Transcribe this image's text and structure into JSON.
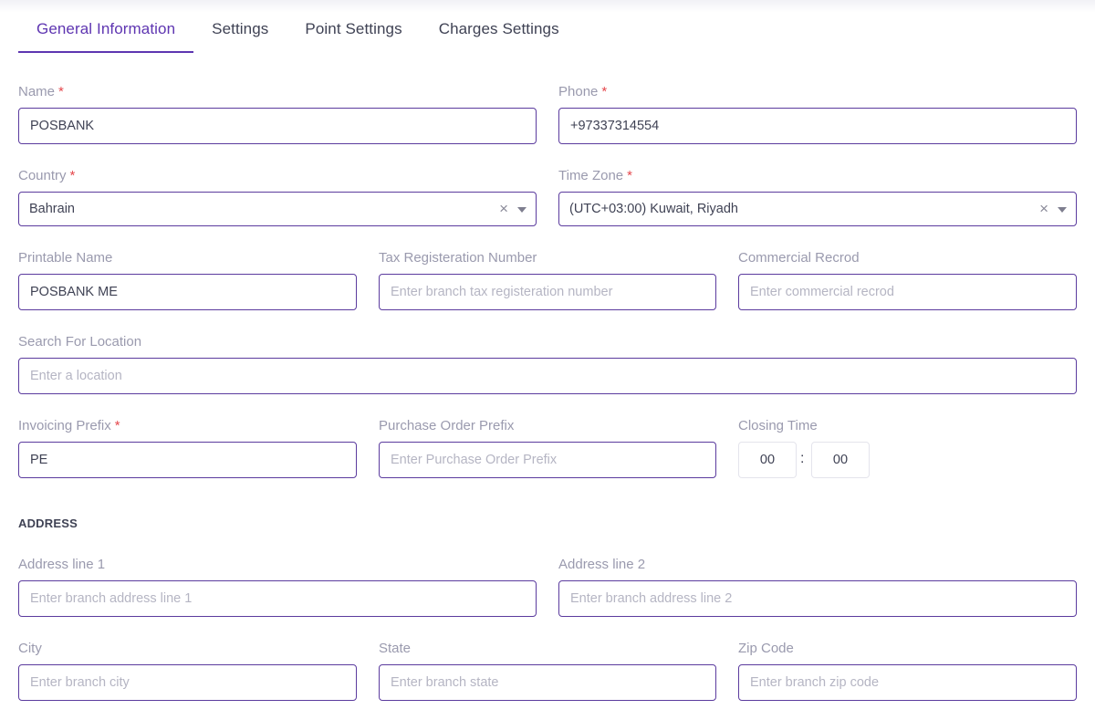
{
  "tabs": [
    "General Information",
    "Settings",
    "Point Settings",
    "Charges Settings"
  ],
  "form": {
    "name": {
      "label": "Name",
      "required": "*",
      "value": "POSBANK"
    },
    "phone": {
      "label": "Phone",
      "required": "*",
      "value": "+97337314554"
    },
    "country": {
      "label": "Country",
      "required": "*",
      "value": "Bahrain",
      "clear": "×"
    },
    "timezone": {
      "label": "Time Zone",
      "required": "*",
      "value": "(UTC+03:00) Kuwait, Riyadh",
      "clear": "×"
    },
    "printable_name": {
      "label": "Printable Name",
      "value": "POSBANK ME"
    },
    "tax_reg": {
      "label": "Tax Registeration Number",
      "placeholder": "Enter branch tax registeration number"
    },
    "commercial": {
      "label": "Commercial Recrod",
      "placeholder": "Enter commercial recrod"
    },
    "location": {
      "label": "Search For Location",
      "placeholder": "Enter a location"
    },
    "invoicing_prefix": {
      "label": "Invoicing Prefix",
      "required": "*",
      "value": "PE"
    },
    "po_prefix": {
      "label": "Purchase Order Prefix",
      "placeholder": "Enter Purchase Order Prefix"
    },
    "closing_time": {
      "label": "Closing Time",
      "hours": "00",
      "separator": ":",
      "minutes": "00"
    }
  },
  "address": {
    "section_title": "ADDRESS",
    "line1": {
      "label": "Address line 1",
      "placeholder": "Enter branch address line 1"
    },
    "line2": {
      "label": "Address line 2",
      "placeholder": "Enter branch address line 2"
    },
    "city": {
      "label": "City",
      "placeholder": "Enter branch city"
    },
    "state": {
      "label": "State",
      "placeholder": "Enter branch state"
    },
    "zip": {
      "label": "Zip Code",
      "placeholder": "Enter branch zip code"
    }
  },
  "colors": {
    "accent": "#5e35b1",
    "required": "#e5484d",
    "label": "#9a9aae"
  }
}
